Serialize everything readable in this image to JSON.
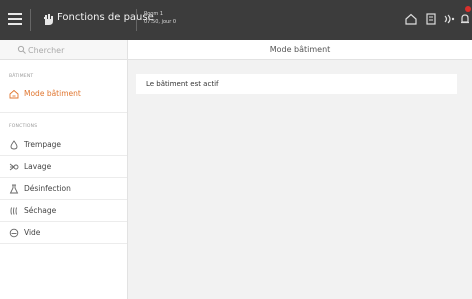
{
  "header": {
    "title": "Fonctions de pause",
    "room_line1": "Room 1",
    "room_line2": "07:50, jour 0",
    "icons": [
      "menu-icon",
      "hand-icon",
      "home-icon",
      "document-icon",
      "signal-icon",
      "bell-icon"
    ],
    "colors": {
      "bar": "#3c3c3c",
      "badge": "#d9302c"
    }
  },
  "sidebar": {
    "search_placeholder": "Chercher",
    "section_main": "Bâtiment",
    "main_items": [
      {
        "label": "Mode bâtiment",
        "icon": "home-icon",
        "active": true
      }
    ],
    "section_functions": "Fonctions",
    "function_items": [
      {
        "label": "Trempage",
        "icon": "drop-icon"
      },
      {
        "label": "Lavage",
        "icon": "spray-icon"
      },
      {
        "label": "Désinfection",
        "icon": "flask-icon"
      },
      {
        "label": "Séchage",
        "icon": "heat-icon"
      },
      {
        "label": "Vide",
        "icon": "empty-icon"
      }
    ],
    "accent_color": "#e0762f"
  },
  "main": {
    "title": "Mode bâtiment",
    "status_text": "Le bâtiment est actif"
  }
}
